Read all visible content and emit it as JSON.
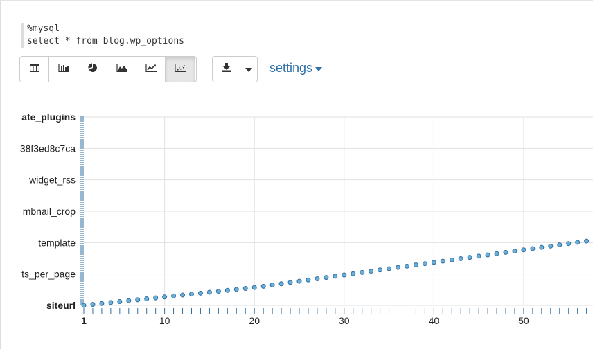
{
  "editor": {
    "line1": "%mysql",
    "line2": "select * from blog.wp_options"
  },
  "toolbar": {
    "viz_buttons": [
      {
        "icon": "table-icon"
      },
      {
        "icon": "bar-chart-icon"
      },
      {
        "icon": "pie-chart-icon"
      },
      {
        "icon": "area-chart-icon"
      },
      {
        "icon": "line-chart-icon"
      },
      {
        "icon": "scatter-chart-icon",
        "active": true
      }
    ],
    "download_icon": "download-icon",
    "caret_icon": "caret-down-icon",
    "settings_label": "settings"
  },
  "colors": {
    "accent": "#3071a9",
    "point_fill": "#6baed6",
    "point_stroke": "#2f6fa3",
    "grid": "#e1e1e1"
  },
  "chart_data": {
    "type": "scatter",
    "title": "",
    "xlabel": "",
    "ylabel": "",
    "xlim": [
      1,
      57.8
    ],
    "x_ticks": [
      1,
      10,
      20,
      30,
      40,
      50
    ],
    "y_categories": [
      "siteurl",
      "ts_per_page",
      "template",
      "mbnail_crop",
      "widget_rss",
      "38f3ed8c7ca",
      "ate_plugins"
    ],
    "y_bold": [
      "siteurl",
      "ate_plugins"
    ],
    "grid": true,
    "series": [
      {
        "x": [
          1,
          2,
          3,
          4,
          5,
          6,
          7,
          8,
          9,
          10,
          11,
          12,
          13,
          14,
          15,
          16,
          17,
          18,
          19,
          20,
          21,
          22,
          23,
          24,
          25,
          26,
          27,
          28,
          29,
          30,
          31,
          32,
          33,
          34,
          35,
          36,
          37,
          38,
          39,
          40,
          41,
          42,
          43,
          44,
          45,
          46,
          47,
          48,
          49,
          50,
          51,
          52,
          53,
          54,
          55,
          56,
          57
        ],
        "y": [
          0.0,
          0.03,
          0.06,
          0.09,
          0.12,
          0.15,
          0.18,
          0.21,
          0.24,
          0.27,
          0.3,
          0.33,
          0.36,
          0.39,
          0.42,
          0.45,
          0.48,
          0.51,
          0.54,
          0.57,
          0.61,
          0.65,
          0.69,
          0.73,
          0.77,
          0.81,
          0.85,
          0.89,
          0.93,
          0.97,
          1.01,
          1.05,
          1.09,
          1.13,
          1.17,
          1.21,
          1.25,
          1.29,
          1.33,
          1.37,
          1.41,
          1.45,
          1.49,
          1.53,
          1.57,
          1.61,
          1.65,
          1.69,
          1.73,
          1.77,
          1.81,
          1.85,
          1.89,
          1.93,
          1.97,
          2.01,
          2.05
        ]
      }
    ]
  }
}
